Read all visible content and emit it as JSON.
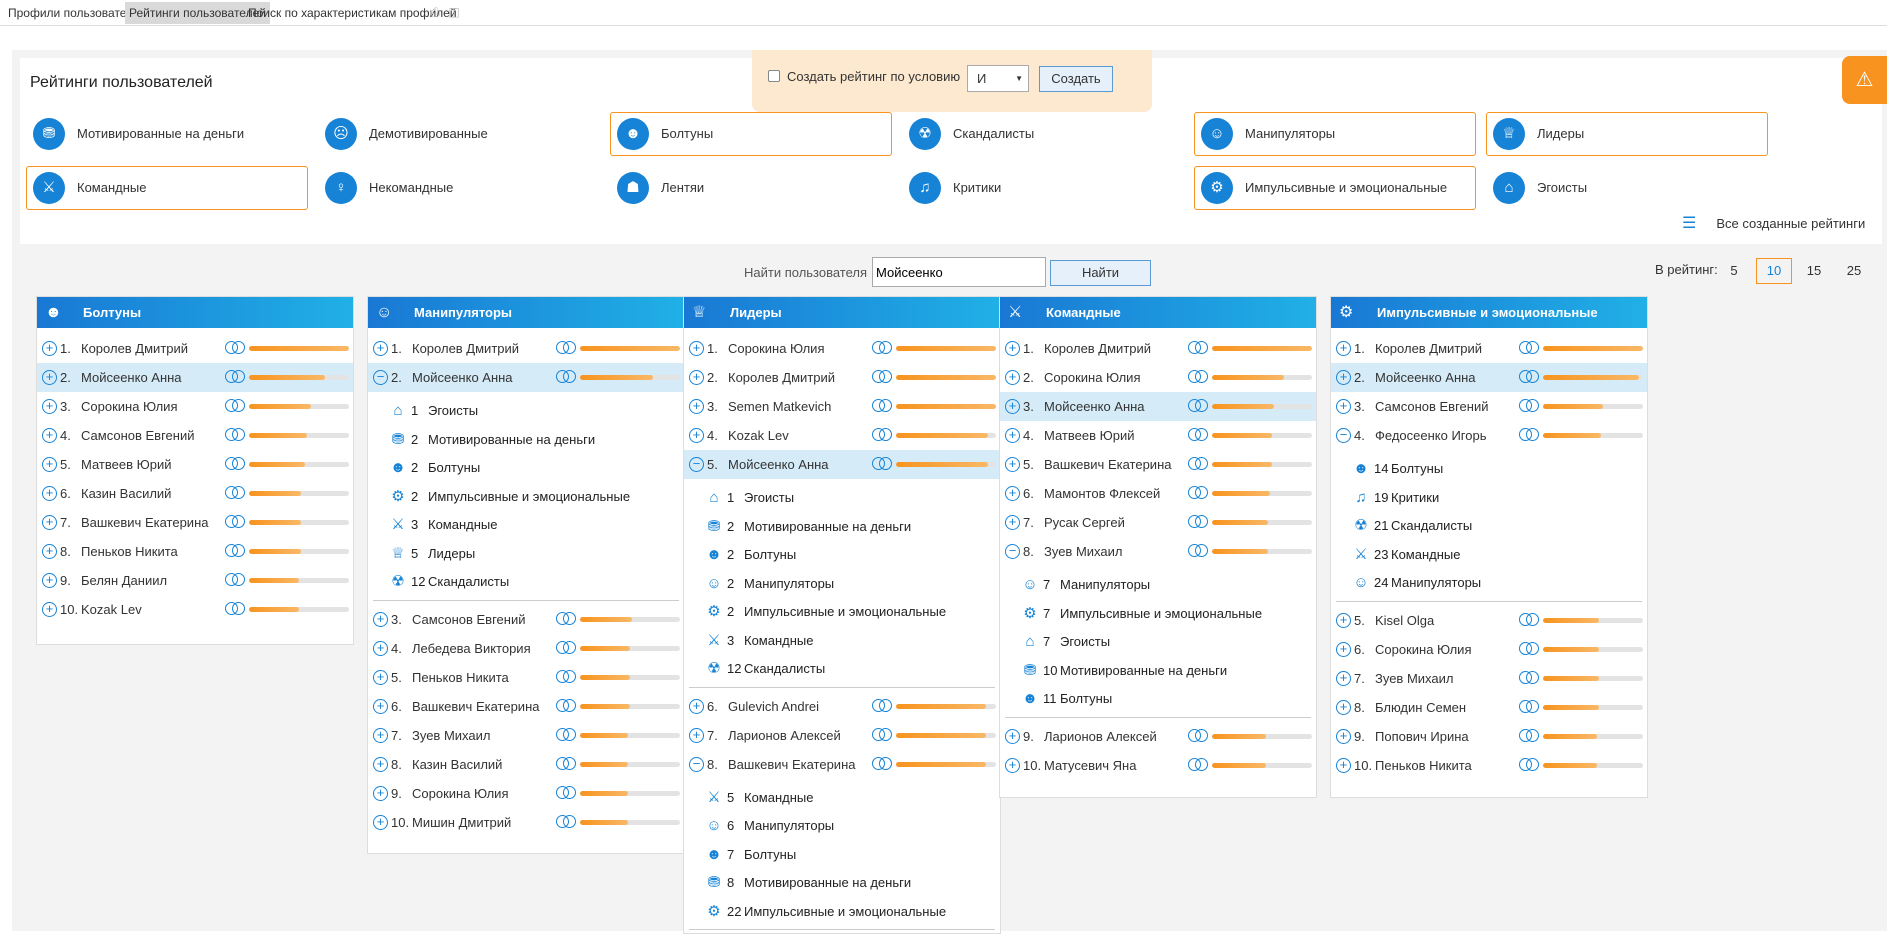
{
  "top_tabs": [
    {
      "label": "Профили пользователей",
      "active": false
    },
    {
      "label": "Рейтинги пользователей",
      "active": true
    },
    {
      "label": "Поиск по характеристикам профилей",
      "active": false
    }
  ],
  "panel": {
    "title": "Рейтинги пользователей",
    "create_condition_label": "Создать рейтинг по условию",
    "condition_value": "И",
    "create_button": "Создать",
    "all_ratings_label": "Все созданные рейтинги"
  },
  "categories": [
    {
      "label": "Мотивированные на деньги",
      "icon": "coins-icon",
      "selected": false
    },
    {
      "label": "Демотивированные",
      "icon": "sad-icon",
      "selected": false
    },
    {
      "label": "Болтуны",
      "icon": "talker-icon",
      "selected": true
    },
    {
      "label": "Скандалисты",
      "icon": "shout-icon",
      "selected": false
    },
    {
      "label": "Манипуляторы",
      "icon": "mask-icon",
      "selected": true
    },
    {
      "label": "Лидеры",
      "icon": "trophy-icon",
      "selected": true
    },
    {
      "label": "Командные",
      "icon": "handshake-icon",
      "selected": true
    },
    {
      "label": "Некомандные",
      "icon": "person-icon",
      "selected": false
    },
    {
      "label": "Лентяи",
      "icon": "bed-icon",
      "selected": false
    },
    {
      "label": "Критики",
      "icon": "megaphone-icon",
      "selected": false
    },
    {
      "label": "Импульсивные и эмоциональные",
      "icon": "grenade-icon",
      "selected": true
    },
    {
      "label": "Эгоисты",
      "icon": "house-icon",
      "selected": false
    }
  ],
  "search": {
    "label": "Найти пользователя",
    "value": "Мойсеенко",
    "button": "Найти"
  },
  "rating_size": {
    "label": "В рейтинг:",
    "options": [
      "5",
      "10",
      "15",
      "25"
    ],
    "active": "10"
  },
  "columns": [
    {
      "title": "Болтуны",
      "icon": "talker-icon",
      "rows": [
        {
          "num": "1.",
          "name": "Королев Дмитрий",
          "score": 1.0,
          "expanded": false,
          "highlight": false
        },
        {
          "num": "2.",
          "name": "Мойсеенко Анна",
          "score": 0.76,
          "expanded": false,
          "highlight": true
        },
        {
          "num": "3.",
          "name": "Сорокина Юлия",
          "score": 0.62,
          "expanded": false,
          "highlight": false
        },
        {
          "num": "4.",
          "name": "Самсонов Евгений",
          "score": 0.58,
          "expanded": false,
          "highlight": false
        },
        {
          "num": "5.",
          "name": "Матвеев Юрий",
          "score": 0.56,
          "expanded": false,
          "highlight": false
        },
        {
          "num": "6.",
          "name": "Казин Василий",
          "score": 0.52,
          "expanded": false,
          "highlight": false
        },
        {
          "num": "7.",
          "name": "Вашкевич Екатерина",
          "score": 0.52,
          "expanded": false,
          "highlight": false
        },
        {
          "num": "8.",
          "name": "Пеньков Никита",
          "score": 0.52,
          "expanded": false,
          "highlight": false
        },
        {
          "num": "9.",
          "name": "Белян Даниил",
          "score": 0.5,
          "expanded": false,
          "highlight": false
        },
        {
          "num": "10.",
          "name": "Kozak Lev",
          "score": 0.5,
          "expanded": false,
          "highlight": false
        }
      ]
    },
    {
      "title": "Манипуляторы",
      "icon": "mask-icon",
      "rows": [
        {
          "num": "1.",
          "name": "Королев Дмитрий",
          "score": 1.0,
          "expanded": false,
          "highlight": false
        },
        {
          "num": "2.",
          "name": "Мойсеенко Анна",
          "score": 0.73,
          "expanded": true,
          "highlight": true,
          "details": [
            {
              "icon": "house-icon",
              "count": "1",
              "label": "Эгоисты"
            },
            {
              "icon": "coins-icon",
              "count": "2",
              "label": "Мотивированные на деньги"
            },
            {
              "icon": "talker-icon",
              "count": "2",
              "label": "Болтуны"
            },
            {
              "icon": "grenade-icon",
              "count": "2",
              "label": "Импульсивные и эмоциональные"
            },
            {
              "icon": "handshake-icon",
              "count": "3",
              "label": "Командные"
            },
            {
              "icon": "trophy-icon",
              "count": "5",
              "label": "Лидеры"
            },
            {
              "icon": "shout-icon",
              "count": "12",
              "label": "Скандалисты"
            }
          ]
        },
        {
          "num": "3.",
          "name": "Самсонов Евгений",
          "score": 0.52,
          "expanded": false,
          "highlight": false
        },
        {
          "num": "4.",
          "name": "Лебедева Виктория",
          "score": 0.5,
          "expanded": false,
          "highlight": false
        },
        {
          "num": "5.",
          "name": "Пеньков Никита",
          "score": 0.5,
          "expanded": false,
          "highlight": false
        },
        {
          "num": "6.",
          "name": "Вашкевич Екатерина",
          "score": 0.5,
          "expanded": false,
          "highlight": false
        },
        {
          "num": "7.",
          "name": "Зуев Михаил",
          "score": 0.48,
          "expanded": false,
          "highlight": false
        },
        {
          "num": "8.",
          "name": "Казин Василий",
          "score": 0.48,
          "expanded": false,
          "highlight": false
        },
        {
          "num": "9.",
          "name": "Сорокина Юлия",
          "score": 0.48,
          "expanded": false,
          "highlight": false
        },
        {
          "num": "10.",
          "name": "Мишин Дмитрий",
          "score": 0.48,
          "expanded": false,
          "highlight": false
        }
      ]
    },
    {
      "title": "Лидеры",
      "icon": "trophy-icon",
      "rows": [
        {
          "num": "1.",
          "name": "Сорокина Юлия",
          "score": 1.0,
          "expanded": false,
          "highlight": false
        },
        {
          "num": "2.",
          "name": "Королев Дмитрий",
          "score": 1.0,
          "expanded": false,
          "highlight": false
        },
        {
          "num": "3.",
          "name": "Semen Matkevich",
          "score": 1.0,
          "expanded": false,
          "highlight": false
        },
        {
          "num": "4.",
          "name": "Kozak Lev",
          "score": 0.92,
          "expanded": false,
          "highlight": false
        },
        {
          "num": "5.",
          "name": "Мойсеенко Анна",
          "score": 0.92,
          "expanded": true,
          "highlight": true,
          "details": [
            {
              "icon": "house-icon",
              "count": "1",
              "label": "Эгоисты"
            },
            {
              "icon": "coins-icon",
              "count": "2",
              "label": "Мотивированные на деньги"
            },
            {
              "icon": "talker-icon",
              "count": "2",
              "label": "Болтуны"
            },
            {
              "icon": "mask-icon",
              "count": "2",
              "label": "Манипуляторы"
            },
            {
              "icon": "grenade-icon",
              "count": "2",
              "label": "Импульсивные и эмоциональные"
            },
            {
              "icon": "handshake-icon",
              "count": "3",
              "label": "Командные"
            },
            {
              "icon": "shout-icon",
              "count": "12",
              "label": "Скандалисты"
            }
          ]
        },
        {
          "num": "6.",
          "name": "Gulevich Andrei",
          "score": 0.9,
          "expanded": false,
          "highlight": false
        },
        {
          "num": "7.",
          "name": "Ларионов Алексей",
          "score": 0.9,
          "expanded": false,
          "highlight": false
        },
        {
          "num": "8.",
          "name": "Вашкевич Екатерина",
          "score": 0.9,
          "expanded": true,
          "highlight": false,
          "details": [
            {
              "icon": "handshake-icon",
              "count": "5",
              "label": "Командные"
            },
            {
              "icon": "mask-icon",
              "count": "6",
              "label": "Манипуляторы"
            },
            {
              "icon": "talker-icon",
              "count": "7",
              "label": "Болтуны"
            },
            {
              "icon": "coins-icon",
              "count": "8",
              "label": "Мотивированные на деньги"
            },
            {
              "icon": "grenade-icon",
              "count": "22",
              "label": "Импульсивные и эмоциональные"
            }
          ]
        }
      ]
    },
    {
      "title": "Командные",
      "icon": "handshake-icon",
      "rows": [
        {
          "num": "1.",
          "name": "Королев Дмитрий",
          "score": 1.0,
          "expanded": false,
          "highlight": false
        },
        {
          "num": "2.",
          "name": "Сорокина Юлия",
          "score": 0.72,
          "expanded": false,
          "highlight": false
        },
        {
          "num": "3.",
          "name": "Мойсеенко Анна",
          "score": 0.62,
          "expanded": false,
          "highlight": true
        },
        {
          "num": "4.",
          "name": "Матвеев Юрий",
          "score": 0.6,
          "expanded": false,
          "highlight": false
        },
        {
          "num": "5.",
          "name": "Вашкевич Екатерина",
          "score": 0.6,
          "expanded": false,
          "highlight": false
        },
        {
          "num": "6.",
          "name": "Мамонтов Флексей",
          "score": 0.58,
          "expanded": false,
          "highlight": false
        },
        {
          "num": "7.",
          "name": "Русак Сергей",
          "score": 0.56,
          "expanded": false,
          "highlight": false
        },
        {
          "num": "8.",
          "name": "Зуев Михаил",
          "score": 0.56,
          "expanded": true,
          "highlight": false,
          "details": [
            {
              "icon": "mask-icon",
              "count": "7",
              "label": "Манипуляторы"
            },
            {
              "icon": "grenade-icon",
              "count": "7",
              "label": "Импульсивные и эмоциональные"
            },
            {
              "icon": "house-icon",
              "count": "7",
              "label": "Эгоисты"
            },
            {
              "icon": "coins-icon",
              "count": "10",
              "label": "Мотивированные на деньги"
            },
            {
              "icon": "talker-icon",
              "count": "11",
              "label": "Болтуны"
            }
          ]
        },
        {
          "num": "9.",
          "name": "Ларионов Алексей",
          "score": 0.54,
          "expanded": false,
          "highlight": false
        },
        {
          "num": "10.",
          "name": "Матусевич Яна",
          "score": 0.54,
          "expanded": false,
          "highlight": false
        }
      ]
    },
    {
      "title": "Импульсивные и эмоциональные",
      "icon": "grenade-icon",
      "rows": [
        {
          "num": "1.",
          "name": "Королев Дмитрий",
          "score": 1.0,
          "expanded": false,
          "highlight": false
        },
        {
          "num": "2.",
          "name": "Мойсеенко Анна",
          "score": 0.96,
          "expanded": false,
          "highlight": true
        },
        {
          "num": "3.",
          "name": "Самсонов Евгений",
          "score": 0.6,
          "expanded": false,
          "highlight": false
        },
        {
          "num": "4.",
          "name": "Федосеенко Игорь",
          "score": 0.58,
          "expanded": true,
          "highlight": false,
          "details": [
            {
              "icon": "talker-icon",
              "count": "14",
              "label": "Болтуны"
            },
            {
              "icon": "megaphone-icon",
              "count": "19",
              "label": "Критики"
            },
            {
              "icon": "shout-icon",
              "count": "21",
              "label": "Скандалисты"
            },
            {
              "icon": "handshake-icon",
              "count": "23",
              "label": "Командные"
            },
            {
              "icon": "mask-icon",
              "count": "24",
              "label": "Манипуляторы"
            }
          ]
        },
        {
          "num": "5.",
          "name": "Kisel Olga",
          "score": 0.56,
          "expanded": false,
          "highlight": false
        },
        {
          "num": "6.",
          "name": "Сорокина Юлия",
          "score": 0.56,
          "expanded": false,
          "highlight": false
        },
        {
          "num": "7.",
          "name": "Зуев Михаил",
          "score": 0.56,
          "expanded": false,
          "highlight": false
        },
        {
          "num": "8.",
          "name": "Блюдин Семен",
          "score": 0.56,
          "expanded": false,
          "highlight": false
        },
        {
          "num": "9.",
          "name": "Попович Ирина",
          "score": 0.54,
          "expanded": false,
          "highlight": false
        },
        {
          "num": "10.",
          "name": "Пеньков Никита",
          "score": 0.54,
          "expanded": false,
          "highlight": false
        }
      ]
    }
  ],
  "colors": {
    "accent": "#1683d6",
    "highlight": "#f7931e",
    "row_highlight": "#d5ecf8"
  }
}
